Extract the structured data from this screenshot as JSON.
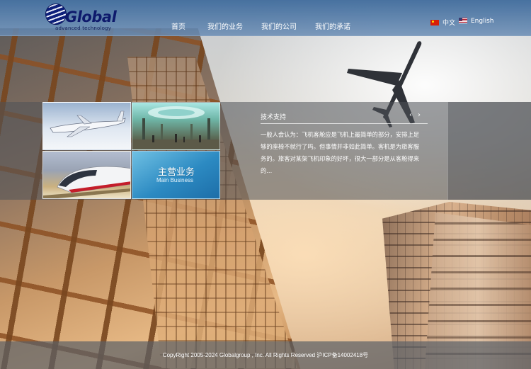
{
  "header": {
    "logo": {
      "brand": "Global",
      "tagline": "advanced technology"
    },
    "nav": [
      {
        "label": "首页"
      },
      {
        "label": "我们的业务"
      },
      {
        "label": "我们的公司"
      },
      {
        "label": "我们的承诺"
      }
    ],
    "languages": [
      {
        "label": "中文",
        "flag": "cn-flag-icon"
      },
      {
        "label": "English",
        "flag": "us-flag-icon"
      }
    ]
  },
  "showcase": {
    "tiles": [
      {
        "name": "jet-image"
      },
      {
        "name": "terminal-hall-image"
      },
      {
        "name": "train-image"
      }
    ],
    "main_business": {
      "title_cn": "主营业务",
      "title_en": "Main Business"
    }
  },
  "info_panel": {
    "title": "技术支持",
    "prev_icon": "‹",
    "next_icon": "›",
    "body": "一般人会认为：飞机客舱应是飞机上最简单的部分，安排上足够的座椅不就行了吗。但事情并非如此简单。客机是为旅客服务的。旅客对某架飞机印象的好坏，很大一部分是从客舱得来的..."
  },
  "footer": {
    "copyright": "CopyRight 2005-2024 Globalgroup , Inc. All Rights Reserved 沪ICP备14002418号"
  },
  "colors": {
    "header": "#3c699b",
    "accent_blue": "#2c8ac2",
    "logo_blue": "#0e1a6c"
  }
}
